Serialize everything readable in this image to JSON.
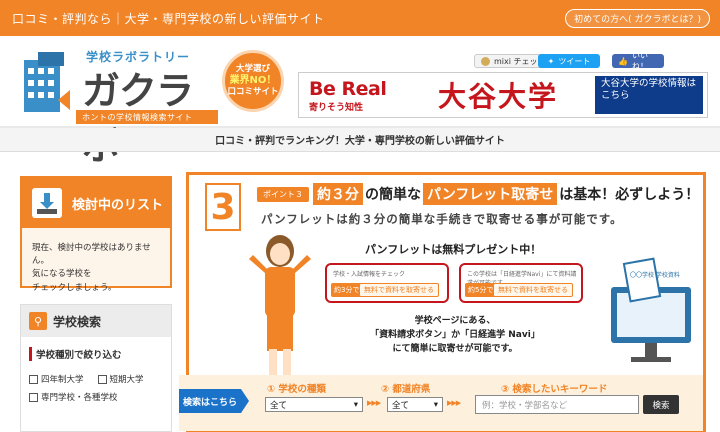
{
  "topbar": {
    "tagline": "口コミ・評判なら｜大学・専門学校の新しい評価サイト",
    "first_button": "初めての方へ( ガクラボとは？)"
  },
  "logo": {
    "subtitle": "学校ラボラトリー",
    "name": "ガクラボ",
    "strip": "ホントの学校情報検索サイト"
  },
  "badge": {
    "line1": "大学選び",
    "line2": "業界NO！",
    "line3": "口コミサイト"
  },
  "social": {
    "mixi": "mixi チェック",
    "tweet": "ツイート",
    "like": "いいね！"
  },
  "banner": {
    "brand": "Be Real",
    "brand_sub": "寄りそう知性",
    "university": "大谷大学",
    "info": "大谷大学の学校情報はこちら"
  },
  "subbar": {
    "text": "口コミ・評判でランキング！大学・専門学校の新しい評価サイト"
  },
  "sidebar": {
    "list_title": "検討中のリスト",
    "list_body_1": "現在、検討中の学校はありません。",
    "list_body_2": "気になる学校を",
    "list_body_3": "チェックしましょう。",
    "search_title": "学校検索",
    "section_title": "学校種別で絞り込む",
    "checks": [
      "四年制大学",
      "短期大学",
      "専門学校・各種学校"
    ]
  },
  "point": {
    "number": "3",
    "tag": "ポイント３",
    "title_hl1": "約３分",
    "title_mid": "の簡単な",
    "title_hl2": "パンフレット取寄せ",
    "title_end": "は基本！必ずしよう！",
    "subtitle": "パンフレットは約３分の簡単な手続きで取寄せる事が可能です。",
    "free_title": "パンフレットは無料プレゼント中！",
    "card1_mini": "学校・入試情報をチェック",
    "card1_pill": "約3分で",
    "card1_pill2": "無料で資料を取寄せる",
    "card2_mini": "この学校は「日経進学Navi」にて資料請求が可能です",
    "card2_pill": "約5分で",
    "card2_pill2": "無料で資料を取寄せる",
    "monitor_label": "〇〇学校 学校資料",
    "school_info_1": "学校ページにある、",
    "school_info_2": "「資料請求ボタン」か「日経進学 Navi」",
    "school_info_3": "にて簡単に取寄せが可能です。"
  },
  "search": {
    "tag": "検索はこちら",
    "label1": "① 学校の種類",
    "label2": "② 都道府県",
    "label3": "③ 検索したいキーワード",
    "select1": "全て",
    "select2": "全て",
    "keyword_placeholder": "例：学校・学部名など",
    "button": "検索"
  }
}
